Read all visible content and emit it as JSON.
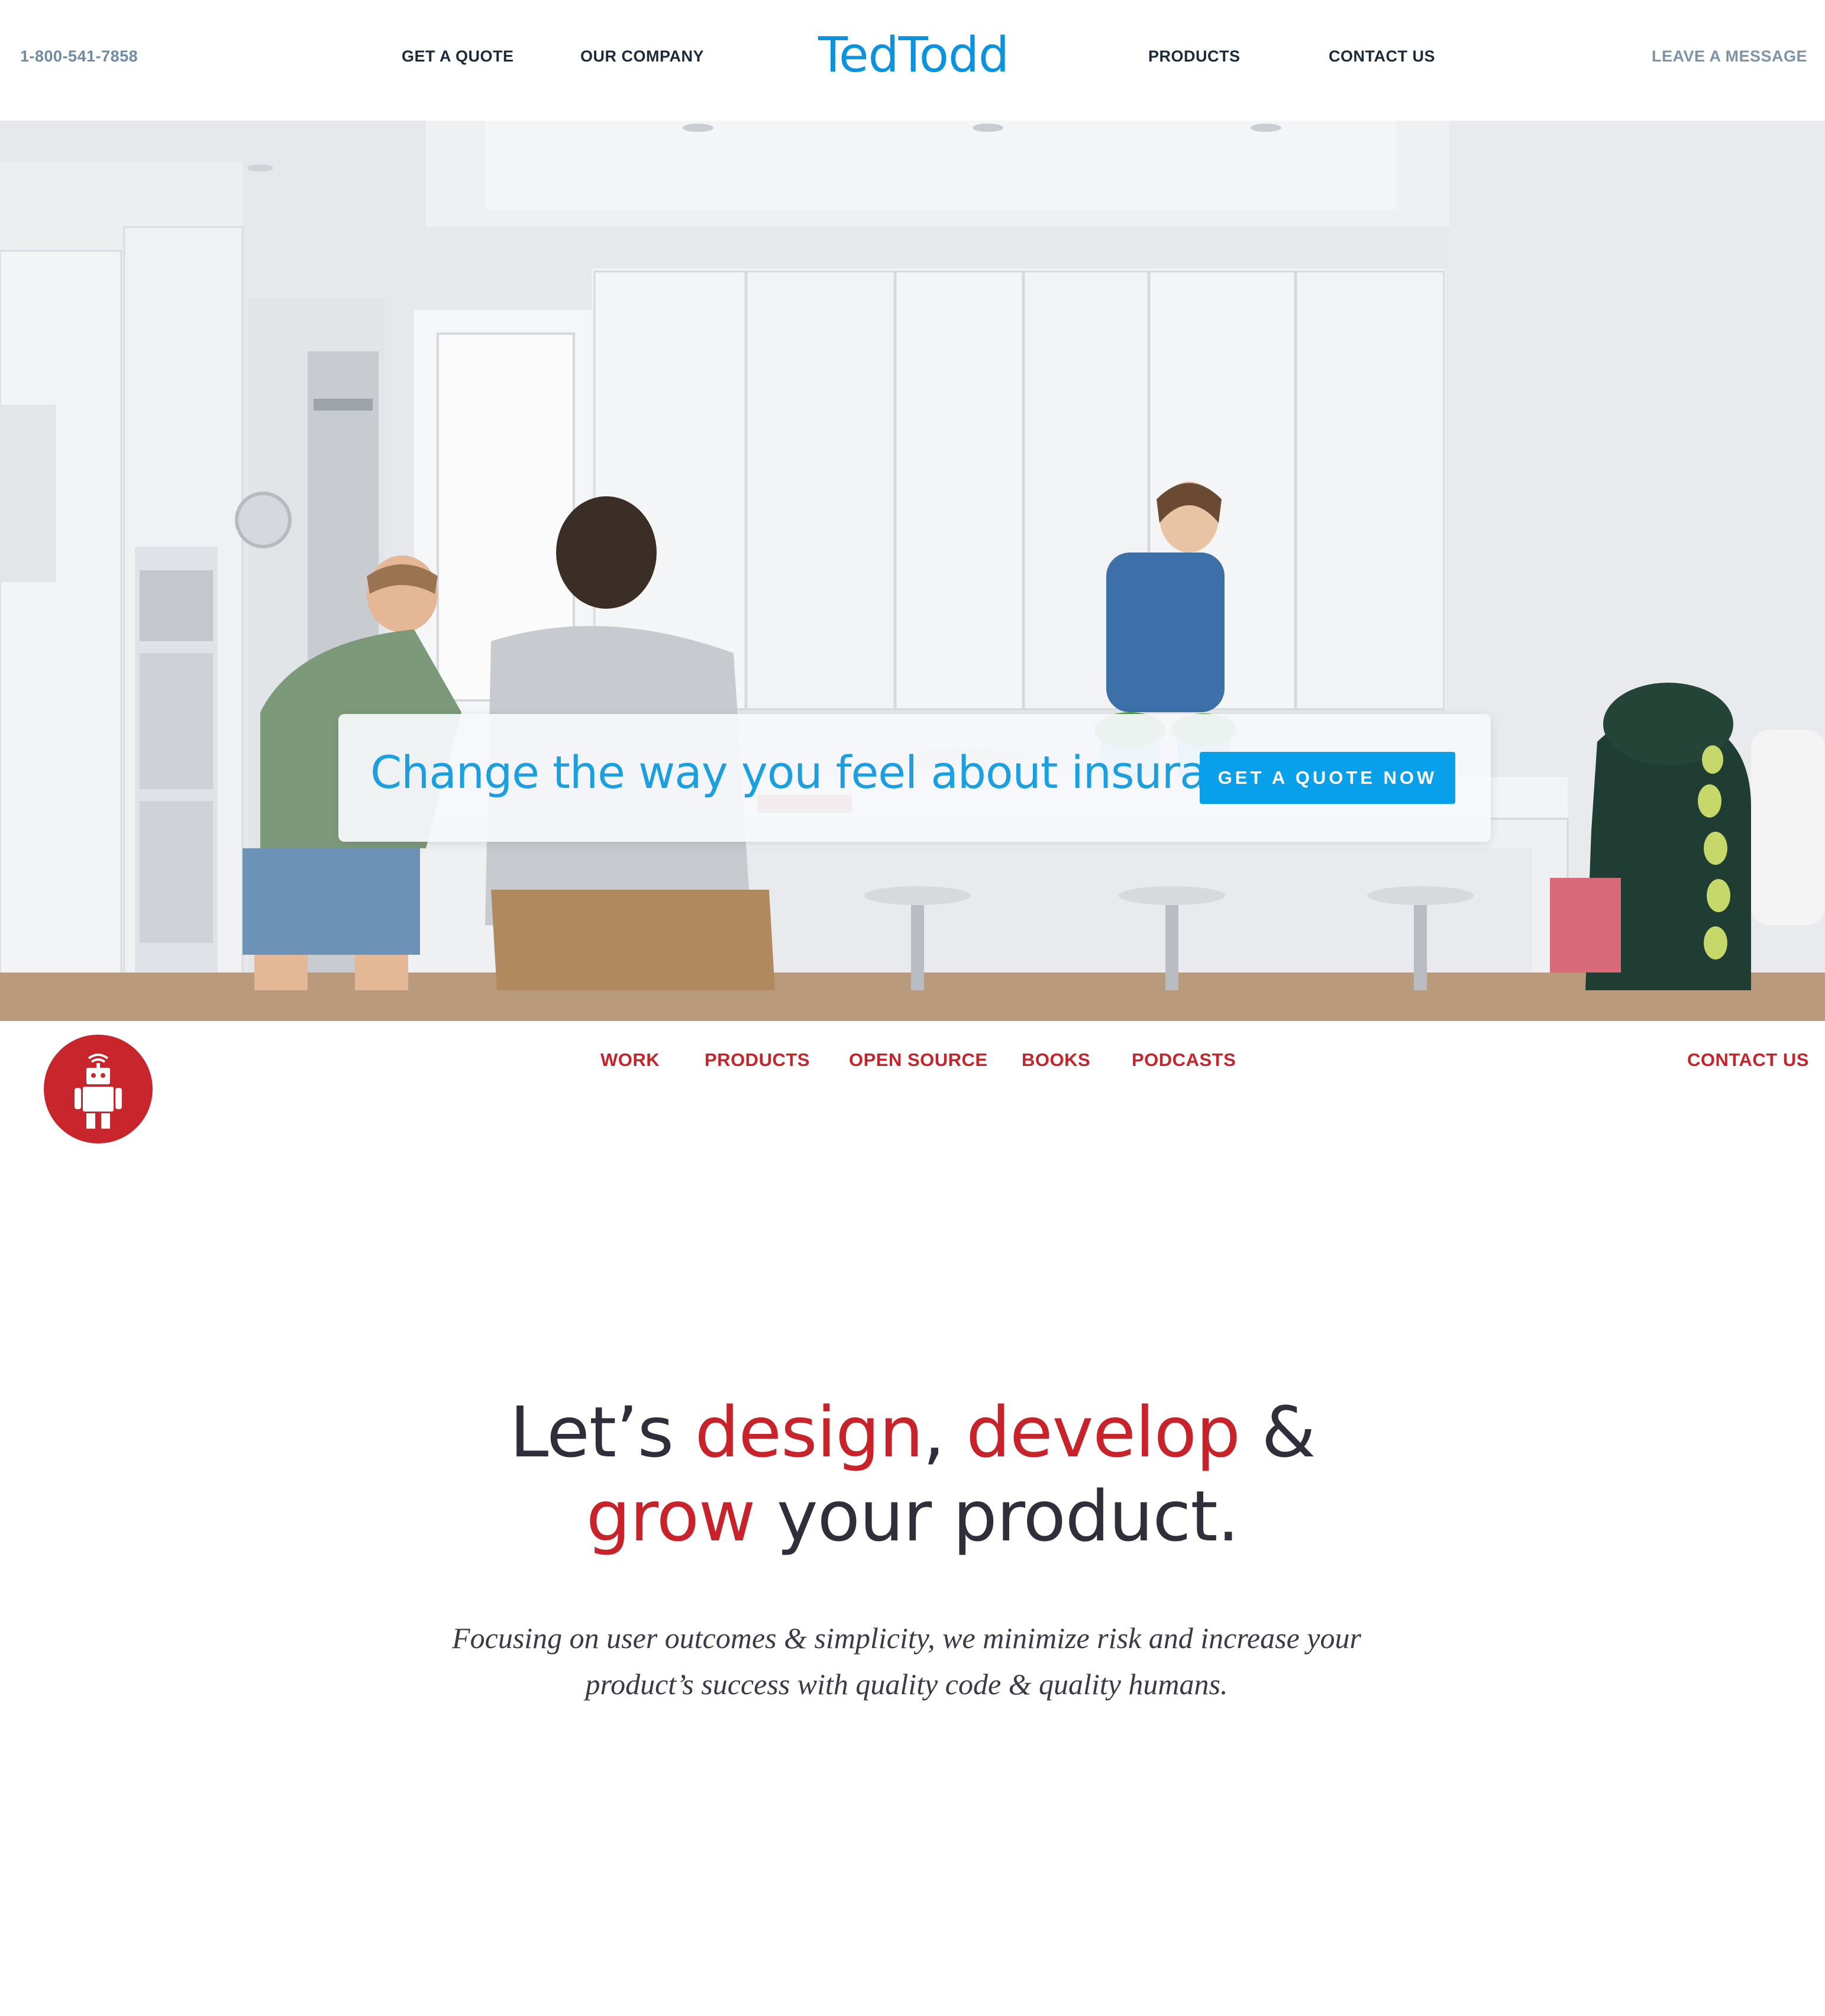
{
  "header": {
    "phone": "1-800-541-7858",
    "get_quote": "GET A QUOTE",
    "our_company": "OUR COMPANY",
    "logo": "TedTodd",
    "products": "PRODUCTS",
    "contact_us": "CONTACT US",
    "leave_message": "LEAVE A MESSAGE"
  },
  "hero": {
    "tagline": "Change the way you feel about insurance.",
    "cta": "GET A QUOTE NOW"
  },
  "nav2": {
    "logo_icon": "robot-icon",
    "work": "WORK",
    "products": "PRODUCTS",
    "open_source": "OPEN SOURCE",
    "books": "BOOKS",
    "podcasts": "PODCASTS",
    "contact_us": "CONTACT US"
  },
  "content": {
    "headline": {
      "part1": "Let’s ",
      "design": "design",
      "comma": ", ",
      "develop": "develop",
      "amp": " &",
      "grow": "grow",
      "rest": " your product."
    },
    "subtext": "Focusing on user outcomes & simplicity, we minimize risk and increase your product’s success with quality code & quality humans."
  },
  "colors": {
    "brand_blue": "#0b93e0",
    "cta_blue": "#08a0ea",
    "brand_red": "#c8232b",
    "text_dark": "#2e2f3b"
  }
}
